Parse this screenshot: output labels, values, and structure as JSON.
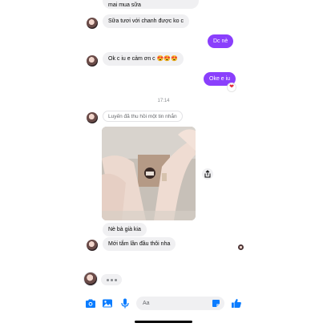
{
  "thread": {
    "partial_top_message_line1": "... ",
    "partial_top_message_line2": "mai mua sữa",
    "messages": [
      {
        "side": "in",
        "text": "Sữa tươi với chanh được ko c"
      },
      {
        "side": "out",
        "text": "Dc nè"
      },
      {
        "side": "in",
        "text": "Ok c iu e cảm ơn c 😍😍😍"
      },
      {
        "side": "out",
        "text": "Oke e iu",
        "reaction": "❤"
      },
      {
        "side": "timestamp",
        "text": "17:14"
      },
      {
        "side": "notice",
        "text": "Luyến đã thu hồi một tin nhắn"
      },
      {
        "side": "in",
        "text": "Nè bà già kia"
      },
      {
        "side": "in",
        "text": "Mới tắm lần đầu thôi nha"
      }
    ]
  },
  "composer": {
    "placeholder": "Aa",
    "icons": [
      "camera-icon",
      "image-icon",
      "microphone-icon",
      "sticker-icon",
      "thumbs-up-icon"
    ]
  },
  "colors": {
    "outgoing_bubble": "#8a3ffc",
    "incoming_bubble": "#f0f0f2",
    "accent_icon": "#0a7cff"
  }
}
